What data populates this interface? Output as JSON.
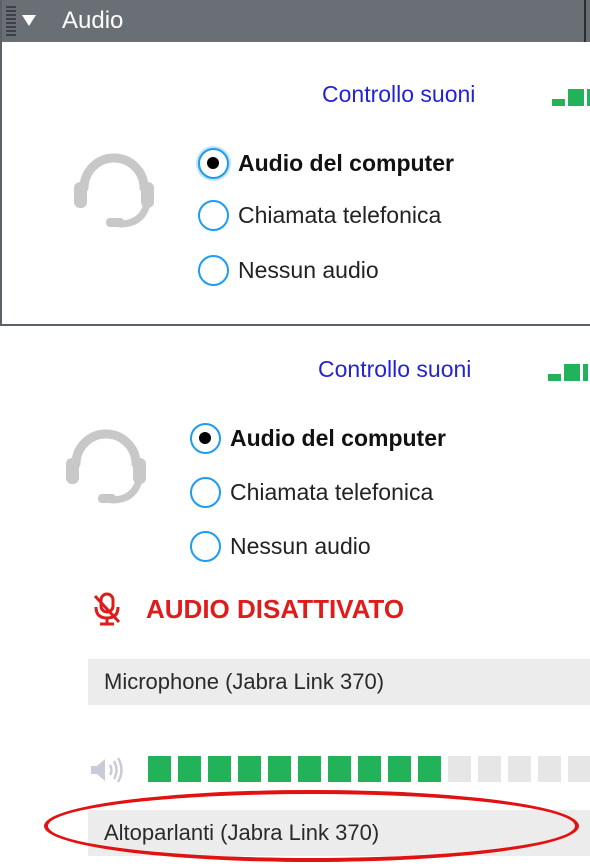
{
  "panel": {
    "title": "Audio",
    "sound_check_label": "Controllo suoni",
    "options": [
      "Audio del computer",
      "Chiamata telefonica",
      "Nessun audio"
    ],
    "selected_option": "Audio del computer"
  },
  "lower": {
    "sound_check_label": "Controllo suoni",
    "options": [
      "Audio del computer",
      "Chiamata telefonica",
      "Nessun audio"
    ],
    "selected_option": "Audio del computer",
    "muted_label": "AUDIO DISATTIVATO",
    "microphone_device": "Microphone (Jabra Link 370)",
    "speaker_device": "Altoparlanti (Jabra Link 370)",
    "speaker_level": {
      "active_segments": 10,
      "visible_segments": 16
    }
  },
  "icons": {
    "headset": "headset-icon",
    "mic_muted": "microphone-muted-icon",
    "speaker": "speaker-volume-icon",
    "collapse": "collapse-triangle-icon"
  },
  "colors": {
    "header_bg": "#6a6e75",
    "link": "#2323d6",
    "level_active": "#22b35a",
    "level_inactive": "#e6e6e6",
    "radio_border": "#1e9cf0",
    "muted_red": "#e01b1b",
    "annotation_red": "#e01212"
  }
}
